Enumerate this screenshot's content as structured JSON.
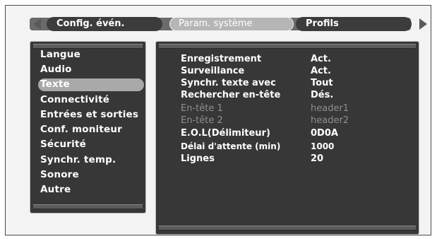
{
  "tabs": [
    {
      "label": "Config. évén."
    },
    {
      "label": "Param. système"
    },
    {
      "label": "Profils"
    }
  ],
  "menu": [
    {
      "label": "Langue"
    },
    {
      "label": "Audio"
    },
    {
      "label": "Texte"
    },
    {
      "label": "Connectivité"
    },
    {
      "label": "Entrées et sorties"
    },
    {
      "label": "Conf. moniteur"
    },
    {
      "label": "Sécurité"
    },
    {
      "label": "Synchr. temp."
    },
    {
      "label": "Sonore"
    },
    {
      "label": "Autre"
    }
  ],
  "selected_menu": "Texte",
  "settings": [
    {
      "label": "Enregistrement",
      "value": "Act."
    },
    {
      "label": "Surveillance",
      "value": "Act."
    },
    {
      "label": "Synchr. texte avec",
      "value": "Tout"
    },
    {
      "label": "Rechercher en-tête",
      "value": "Dés."
    },
    {
      "label": "En-tête 1",
      "value": "header1",
      "disabled": true
    },
    {
      "label": "En-tête 2",
      "value": "header2",
      "disabled": true
    },
    {
      "label": "E.O.L(Délimiteur)",
      "value": "0D0A"
    },
    {
      "label": "Délai d'attente (min)",
      "value": "1000"
    },
    {
      "label": "Lignes",
      "value": "20"
    }
  ],
  "icons": {
    "left": "arrow-left-icon",
    "right": "arrow-right-icon"
  }
}
